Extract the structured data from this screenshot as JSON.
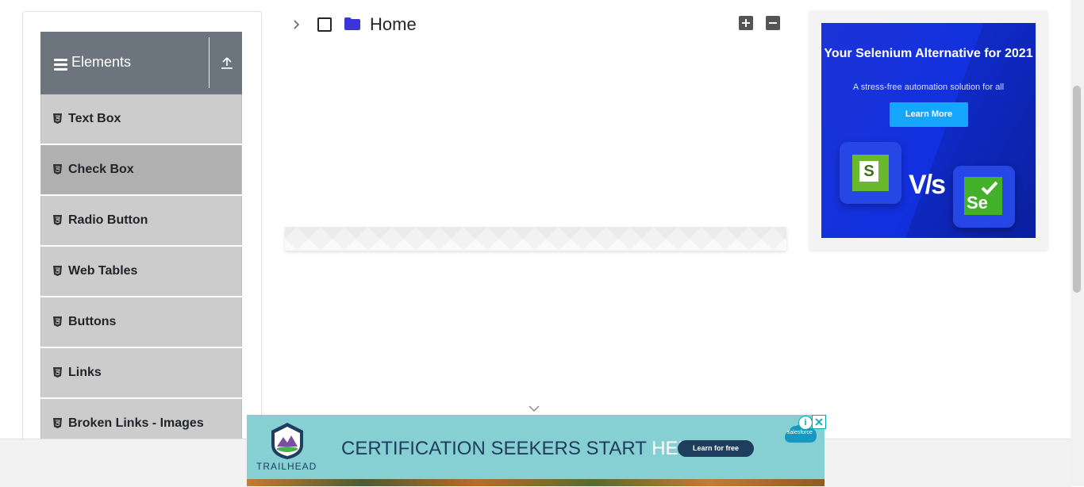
{
  "sidebar": {
    "group_title": "Elements",
    "items": [
      {
        "label": "Text Box",
        "active": false
      },
      {
        "label": "Check Box",
        "active": true
      },
      {
        "label": "Radio Button",
        "active": false
      },
      {
        "label": "Web Tables",
        "active": false
      },
      {
        "label": "Buttons",
        "active": false
      },
      {
        "label": "Links",
        "active": false
      },
      {
        "label": "Broken Links - Images",
        "active": false
      }
    ]
  },
  "tree": {
    "root_label": "Home",
    "checked": false,
    "expanded": false,
    "icons": {
      "toggle": "chevron-right-icon",
      "folder": "folder-icon",
      "expand_all": "plus-square-icon",
      "collapse_all": "minus-square-icon"
    }
  },
  "right_ad": {
    "headline": "Your Selenium Alternative for 2021",
    "subtext": "A stress-free automation solution for all",
    "cta": "Learn More",
    "logo_left": "S",
    "versus": "V/s",
    "logo_right": "Se"
  },
  "bottom_ad": {
    "brand": "TRAILHEAD",
    "headline_main": "CERTIFICATION SEEKERS START ",
    "headline_accent": "HERE.",
    "cta": "Learn for free",
    "partner": "salesforce",
    "info_glyph": "i"
  },
  "colors": {
    "sidebar_header": "#6c757d",
    "menu_item": "#cccccc",
    "menu_item_active": "#b0b0b0",
    "folder": "#3b35d8",
    "ad_blue": "#1230e0",
    "ad_teal": "#86cfd3"
  }
}
